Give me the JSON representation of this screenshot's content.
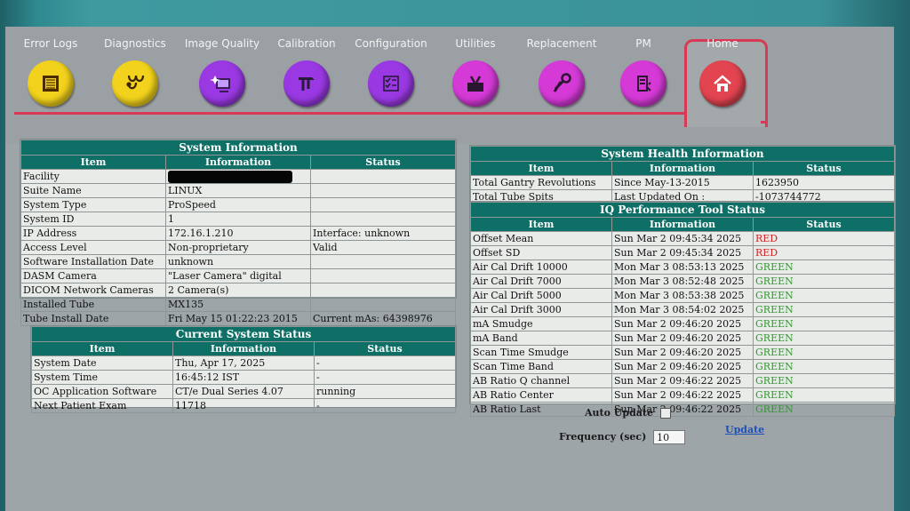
{
  "toolbar": {
    "items": [
      {
        "label": "Error Logs",
        "icon": "log-sheet-icon",
        "color": "#f2d21c"
      },
      {
        "label": "Diagnostics",
        "icon": "stethoscope-icon",
        "color": "#f2d21c"
      },
      {
        "label": "Image Quality",
        "icon": "image-quality-icon",
        "color": "#9a39e3"
      },
      {
        "label": "Calibration",
        "icon": "caliper-icon",
        "color": "#9a39e3"
      },
      {
        "label": "Configuration",
        "icon": "checklist-icon",
        "color": "#9a39e3"
      },
      {
        "label": "Utilities",
        "icon": "toolbox-icon",
        "color": "#d53ad7"
      },
      {
        "label": "Replacement",
        "icon": "wrench-icon",
        "color": "#d53ad7"
      },
      {
        "label": "PM",
        "icon": "maintenance-icon",
        "color": "#d53ad7"
      },
      {
        "label": "Home",
        "icon": "home-icon",
        "color": "#e24450"
      }
    ]
  },
  "system_information": {
    "title": "System Information",
    "headers": [
      "Item",
      "Information",
      "Status"
    ],
    "rows": [
      [
        "Facility",
        "",
        ""
      ],
      [
        "Suite Name",
        "LINUX",
        ""
      ],
      [
        "System Type",
        "ProSpeed",
        ""
      ],
      [
        "System ID",
        "1",
        ""
      ],
      [
        "IP Address",
        "172.16.1.210",
        "Interface: unknown"
      ],
      [
        "Access Level",
        "Non-proprietary",
        "Valid"
      ],
      [
        "Software Installation Date",
        "unknown",
        ""
      ],
      [
        "DASM Camera",
        "\"Laser Camera\" digital",
        ""
      ],
      [
        "DICOM Network Cameras",
        "2 Camera(s)",
        ""
      ],
      [
        "Installed Tube",
        "MX135",
        ""
      ],
      [
        "Tube Install Date",
        "Fri May 15 01:22:23 2015",
        "Current mAs: 64398976"
      ]
    ]
  },
  "current_system_status": {
    "title": "Current System Status",
    "headers": [
      "Item",
      "Information",
      "Status"
    ],
    "rows": [
      [
        "System Date",
        "Thu, Apr 17, 2025",
        "-"
      ],
      [
        "System Time",
        "16:45:12 IST",
        "-"
      ],
      [
        "OC Application Software",
        "CT/e Dual Series 4.07",
        "running"
      ],
      [
        "Next Patient Exam",
        "11718",
        "-"
      ]
    ]
  },
  "system_health_information": {
    "title": "System Health Information",
    "headers": [
      "Item",
      "Information",
      "Status"
    ],
    "rows": [
      [
        "Total Gantry Revolutions",
        "Since May-13-2015",
        "1623950"
      ],
      [
        "Total Tube Spits",
        "Last Updated On :",
        "-1073744772"
      ]
    ]
  },
  "iq_performance": {
    "title": "IQ Performance Tool Status",
    "headers": [
      "Item",
      "Information",
      "Status"
    ],
    "rows": [
      [
        "Offset Mean",
        "Sun Mar 2 09:45:34 2025",
        "RED"
      ],
      [
        "Offset SD",
        "Sun Mar 2 09:45:34 2025",
        "RED"
      ],
      [
        "Air Cal Drift 10000",
        "Mon Mar 3 08:53:13 2025",
        "GREEN"
      ],
      [
        "Air Cal Drift 7000",
        "Mon Mar 3 08:52:48 2025",
        "GREEN"
      ],
      [
        "Air Cal Drift 5000",
        "Mon Mar 3 08:53:38 2025",
        "GREEN"
      ],
      [
        "Air Cal Drift 3000",
        "Mon Mar 3 08:54:02 2025",
        "GREEN"
      ],
      [
        "mA Smudge",
        "Sun Mar 2 09:46:20 2025",
        "GREEN"
      ],
      [
        "mA Band",
        "Sun Mar 2 09:46:20 2025",
        "GREEN"
      ],
      [
        "Scan Time Smudge",
        "Sun Mar 2 09:46:20 2025",
        "GREEN"
      ],
      [
        "Scan Time Band",
        "Sun Mar 2 09:46:20 2025",
        "GREEN"
      ],
      [
        "AB Ratio Q channel",
        "Sun Mar 2 09:46:22 2025",
        "GREEN"
      ],
      [
        "AB Ratio Center",
        "Sun Mar 2 09:46:22 2025",
        "GREEN"
      ],
      [
        "AB Ratio Last",
        "Sun Mar 2 09:46:22 2025",
        "GREEN"
      ]
    ]
  },
  "controls": {
    "auto_update_label": "Auto Update",
    "frequency_label": "Frequency (sec)",
    "frequency_value": "10",
    "update_link": "Update"
  },
  "colors": {
    "header_teal": "#0e6f66",
    "status_red": "#d62222",
    "status_green": "#2f9a2f",
    "home_highlight": "#d83a55"
  }
}
